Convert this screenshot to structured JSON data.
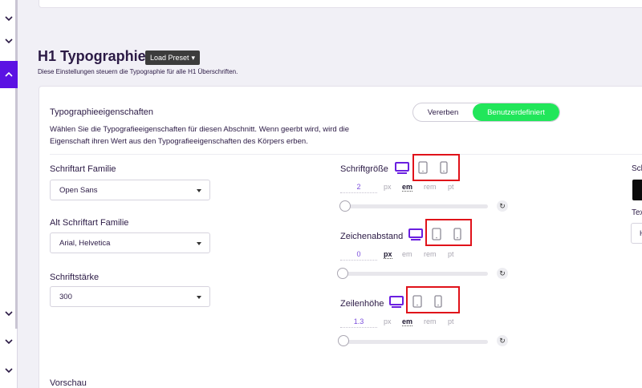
{
  "rail": {
    "buttons": [
      {
        "name": "rail-chevron-down-1",
        "dir": "down",
        "active": false
      },
      {
        "name": "rail-chevron-down-2",
        "dir": "down",
        "active": false
      },
      {
        "name": "rail-chevron-up",
        "dir": "up",
        "active": true
      },
      {
        "name": "rail-chevron-down-3",
        "dir": "down",
        "active": false
      },
      {
        "name": "rail-chevron-down-4",
        "dir": "down",
        "active": false
      },
      {
        "name": "rail-chevron-down-5",
        "dir": "down",
        "active": false
      }
    ]
  },
  "section": {
    "title": "H1 Typographie",
    "preset_label": "Load Preset",
    "description": "Diese Einstellungen steuern die Typographie für alle H1 Überschriften."
  },
  "props": {
    "title": "Typographieeigenschaften",
    "description": "Wählen Sie die Typografieeigenschaften für diesen Abschnitt. Wenn geerbt wird, wird die Eigenschaft ihren Wert aus den Typografieeigenschaften des Körpers erben.",
    "toggle": {
      "inherit_label": "Vererben",
      "custom_label": "Benutzerdefiniert",
      "selected": "custom"
    }
  },
  "fields": {
    "font_family": {
      "label": "Schriftart Familie",
      "value": "Open Sans"
    },
    "alt_font_family": {
      "label": "Alt Schriftart Familie",
      "value": "Arial, Helvetica"
    },
    "font_weight": {
      "label": "Schriftstärke",
      "value": "300"
    }
  },
  "controls": {
    "font_size": {
      "label": "Schriftgröße",
      "value": "2",
      "units": [
        "px",
        "em",
        "rem",
        "pt"
      ],
      "active_unit": "em",
      "slider_level": 0
    },
    "letter_spacing": {
      "label": "Zeichenabstand",
      "value": "0",
      "units": [
        "px",
        "em",
        "rem",
        "pt"
      ],
      "active_unit": "px",
      "slider_level": 0
    },
    "line_height": {
      "label": "Zeilenhöhe",
      "value": "1.3",
      "units": [
        "px",
        "em",
        "rem",
        "pt"
      ],
      "active_unit": "em",
      "slider_level": 0
    }
  },
  "right_fragments": {
    "top": "Sch",
    "middle": "Tex",
    "box_char": "H"
  },
  "preview": {
    "label": "Vorschau"
  },
  "colors": {
    "accent": "#5b12e3",
    "toggle_active": "#21e65a",
    "highlight": "#e0121a",
    "value_text": "#7a4ddc"
  }
}
